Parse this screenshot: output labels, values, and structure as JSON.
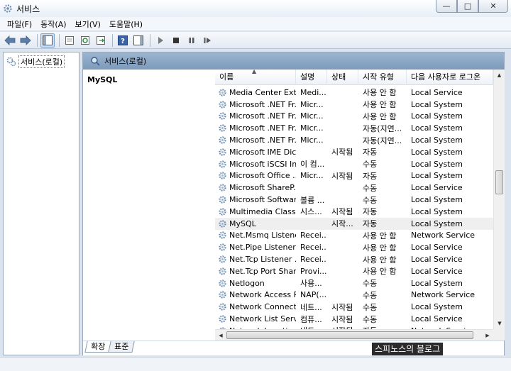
{
  "window": {
    "title": "서비스",
    "icon": "gears-icon",
    "controls": [
      "minimize",
      "maximize",
      "close"
    ]
  },
  "menu": [
    "파일(F)",
    "동작(A)",
    "보기(V)",
    "도움말(H)"
  ],
  "tree": {
    "root_label": "서비스(로컬)"
  },
  "header": {
    "title": "서비스(로컬)"
  },
  "details": {
    "title": "MySQL"
  },
  "columns": [
    "이름",
    "설명",
    "상태",
    "시작 유형",
    "다음 사용자로 로그온"
  ],
  "rows": [
    {
      "name": "Media Center Ext...",
      "desc": "Medi...",
      "status": "",
      "startup": "사용 안 함",
      "logon": "Local Service"
    },
    {
      "name": "Microsoft .NET Fr...",
      "desc": "Micr...",
      "status": "",
      "startup": "사용 안 함",
      "logon": "Local System"
    },
    {
      "name": "Microsoft .NET Fr...",
      "desc": "Micr...",
      "status": "",
      "startup": "사용 안 함",
      "logon": "Local System"
    },
    {
      "name": "Microsoft .NET Fr...",
      "desc": "Micr...",
      "status": "",
      "startup": "자동(지연...",
      "logon": "Local System"
    },
    {
      "name": "Microsoft .NET Fr...",
      "desc": "Micr...",
      "status": "",
      "startup": "자동(지연...",
      "logon": "Local System"
    },
    {
      "name": "Microsoft IME Dic...",
      "desc": "",
      "status": "시작됨",
      "startup": "자동",
      "logon": "Local System"
    },
    {
      "name": "Microsoft iSCSI In...",
      "desc": "이 컴...",
      "status": "",
      "startup": "수동",
      "logon": "Local System"
    },
    {
      "name": "Microsoft Office ...",
      "desc": "Micr...",
      "status": "시작됨",
      "startup": "자동",
      "logon": "Local System"
    },
    {
      "name": "Microsoft ShareP...",
      "desc": "",
      "status": "",
      "startup": "수동",
      "logon": "Local Service"
    },
    {
      "name": "Microsoft Softwar...",
      "desc": "볼륨 ...",
      "status": "",
      "startup": "수동",
      "logon": "Local System"
    },
    {
      "name": "Multimedia Class ...",
      "desc": "시스...",
      "status": "시작됨",
      "startup": "자동",
      "logon": "Local System"
    },
    {
      "name": "MySQL",
      "desc": "",
      "status": "시작...",
      "startup": "자동",
      "logon": "Local System",
      "selected": true
    },
    {
      "name": "Net.Msmq Listene...",
      "desc": "Recei...",
      "status": "",
      "startup": "사용 안 함",
      "logon": "Network Service"
    },
    {
      "name": "Net.Pipe Listener ...",
      "desc": "Recei...",
      "status": "",
      "startup": "사용 안 함",
      "logon": "Local Service"
    },
    {
      "name": "Net.Tcp Listener ...",
      "desc": "Recei...",
      "status": "",
      "startup": "사용 안 함",
      "logon": "Local Service"
    },
    {
      "name": "Net.Tcp Port Shar...",
      "desc": "Provi...",
      "status": "",
      "startup": "사용 안 함",
      "logon": "Local Service"
    },
    {
      "name": "Netlogon",
      "desc": "사용...",
      "status": "",
      "startup": "수동",
      "logon": "Local System"
    },
    {
      "name": "Network Access P...",
      "desc": "NAP(...",
      "status": "",
      "startup": "수동",
      "logon": "Network Service"
    },
    {
      "name": "Network Connecti...",
      "desc": "네트...",
      "status": "시작됨",
      "startup": "수동",
      "logon": "Local System"
    },
    {
      "name": "Network List Servi...",
      "desc": "컴퓨...",
      "status": "시작됨",
      "startup": "수동",
      "logon": "Local Service"
    },
    {
      "name": "Network Location...",
      "desc": "네트...",
      "status": "시작됨",
      "startup": "자동",
      "logon": "Network Service"
    }
  ],
  "tabs": [
    "확장",
    "표준"
  ],
  "watermark": "스피노스의 블로그",
  "colors": {
    "header_bg": "#8aa6c4",
    "selection": "#efefef",
    "gear": "#6b8cb0"
  }
}
